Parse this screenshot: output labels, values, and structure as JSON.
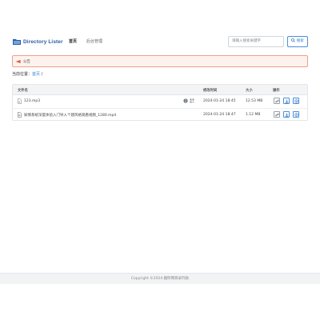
{
  "app": {
    "logo_text": "Directory Lister"
  },
  "nav": {
    "items": [
      {
        "label": "首页",
        "active": true
      },
      {
        "label": "后台管理",
        "active": false
      }
    ]
  },
  "search": {
    "placeholder": "请输入搜索关键字",
    "button_label": "搜索"
  },
  "notice": {
    "text": "公告"
  },
  "breadcrumb": {
    "prefix": "当前位置：",
    "home": "首页",
    "separator": "/"
  },
  "table": {
    "headers": {
      "name": "文件名",
      "modified": "修改时间",
      "size": "大小",
      "actions": "操作"
    },
    "rows": [
      {
        "name": "123.mp3",
        "modified": "2024-01-24 18:45",
        "size": "12.53 MB",
        "icon": "audio-file-icon"
      },
      {
        "name": "知情系统深度体验入门导入个建风格观看视频_1280.mp4",
        "modified": "2024-01-24 18:47",
        "size": "1.12 MB",
        "icon": "video-file-icon"
      }
    ]
  },
  "footer": {
    "text": "Copyright ©2024 趣昕网目录列表"
  },
  "colors": {
    "brand": "#2a5d9f",
    "accent": "#3a7fcf",
    "notice_border": "#f0a08c",
    "notice_icon": "#e2553a"
  }
}
